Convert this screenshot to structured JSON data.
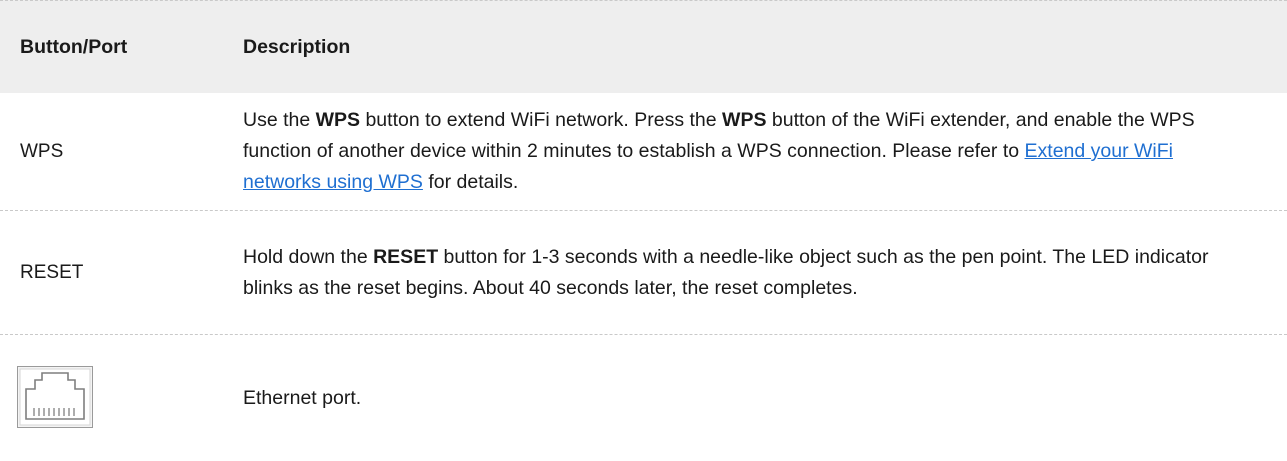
{
  "header": {
    "col1": "Button/Port",
    "col2": "Description"
  },
  "rows": {
    "wps": {
      "name": "WPS",
      "desc": {
        "p1": "Use the ",
        "b1": "WPS",
        "p2": " button to extend WiFi network. Press the ",
        "b2": "WPS",
        "p3": " button of the WiFi extender, and enable the WPS function of another device within 2 minutes to establish a WPS connection. Please refer to ",
        "link": "Extend your WiFi networks using WPS",
        "p4": " for details."
      }
    },
    "reset": {
      "name": "RESET",
      "desc": {
        "p1": "Hold down the ",
        "b1": "RESET",
        "p2": " button for 1-3 seconds with a needle-like object such as the pen point. The LED indicator blinks as the reset begins. About 40 seconds later, the reset completes."
      }
    },
    "ethernet": {
      "icon": "ethernet-port-icon",
      "desc": "Ethernet port."
    }
  },
  "colors": {
    "header_bg": "#eeeeee",
    "link": "#1f6fd1",
    "divider": "#c9c9c9"
  }
}
